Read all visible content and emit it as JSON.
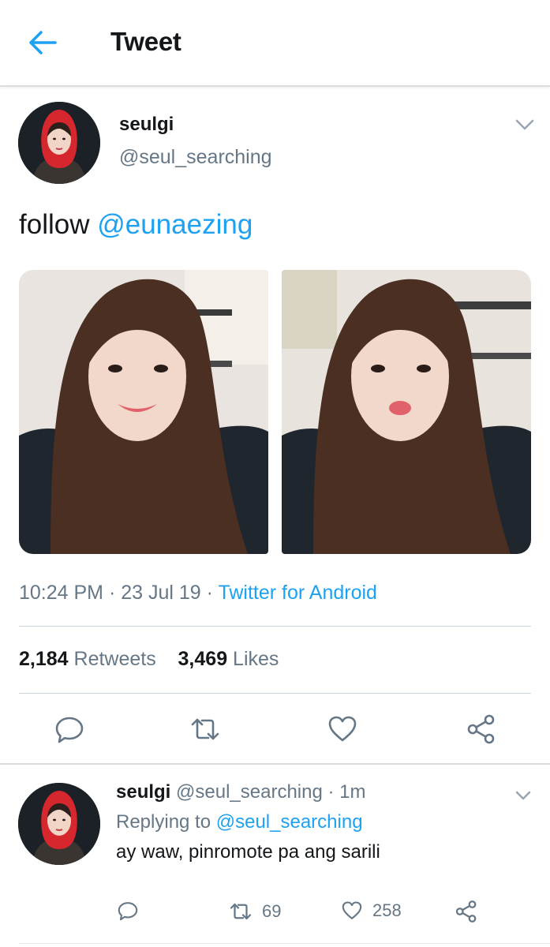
{
  "header": {
    "title": "Tweet"
  },
  "tweet": {
    "name": "seulgi",
    "handle": "@seul_searching",
    "text": "follow ",
    "mention": "@eunaezing",
    "time": "10:24 PM · 23 Jul 19 · ",
    "source": "Twitter for Android",
    "retweet_count": "2,184",
    "retweet_label": " Retweets",
    "like_count": "3,469",
    "like_label": " Likes"
  },
  "reply": {
    "name": "seulgi",
    "handle": "@seul_searching",
    "time": " · 1m",
    "replying_prefix": "Replying to ",
    "replying_to": "@seul_searching",
    "text": "ay waw, pinromote pa ang sarili",
    "retweets": "69",
    "likes": "258"
  },
  "colors": {
    "accent": "#1da1f2",
    "muted": "#657786",
    "text": "#14171a"
  },
  "icons": [
    "back-arrow-icon",
    "chevron-down-icon",
    "reply-icon",
    "retweet-icon",
    "heart-icon",
    "share-icon"
  ]
}
